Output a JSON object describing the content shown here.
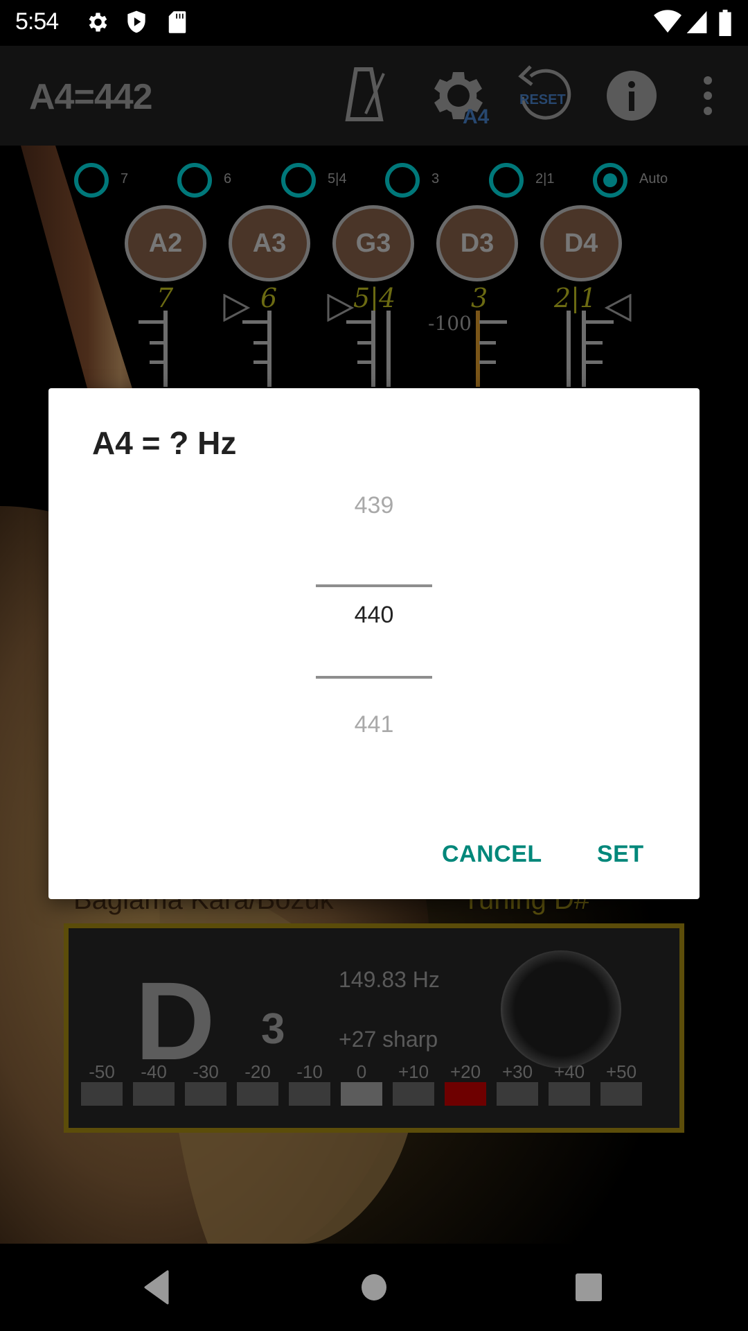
{
  "status_bar": {
    "time": "5:54",
    "left_icons": [
      "settings-icon",
      "shield-play-icon",
      "sd-card-icon"
    ],
    "right_icons": [
      "wifi-icon",
      "signal-icon",
      "battery-icon"
    ]
  },
  "toolbar": {
    "title": "A4=442",
    "actions": [
      {
        "name": "metronome-icon"
      },
      {
        "name": "a4-settings-icon",
        "badge": "A4"
      },
      {
        "name": "reset-icon",
        "badge": "RESET"
      },
      {
        "name": "info-icon"
      },
      {
        "name": "more-options-icon"
      }
    ]
  },
  "string_selector": {
    "options": [
      {
        "label": "7",
        "checked": false
      },
      {
        "label": "6",
        "checked": false
      },
      {
        "label": "5|4",
        "checked": false
      },
      {
        "label": "3",
        "checked": false
      },
      {
        "label": "2|1",
        "checked": false
      },
      {
        "label": "Auto",
        "checked": true
      }
    ],
    "accent_color": "#00787a"
  },
  "note_buttons": [
    "A2",
    "A3",
    "G3",
    "D3",
    "D4"
  ],
  "pegs": {
    "labels": [
      "7",
      "6",
      "5|4",
      "3",
      "2|1"
    ],
    "scale_label": "-100",
    "peg_label_color": "#6b6a12"
  },
  "instrument": {
    "name": "Bağlama Kara/Bozuk",
    "tuning": "Tuning D#"
  },
  "meter": {
    "note": "D",
    "octave": "3",
    "frequency": "149.83 Hz",
    "deviation": "+27 sharp",
    "scale": [
      "-50",
      "-40",
      "-30",
      "-20",
      "-10",
      "0",
      "+10",
      "+20",
      "+30",
      "+40",
      "+50"
    ],
    "active_index": 7,
    "center_index": 5,
    "active_color": "#6e0000"
  },
  "dialog": {
    "title": "A4 = ? Hz",
    "picker": {
      "previous": "439",
      "selected": "440",
      "next": "441"
    },
    "cancel_label": "CANCEL",
    "set_label": "SET",
    "button_color": "#00877a"
  },
  "nav_bar": {
    "buttons": [
      "back-icon",
      "home-icon",
      "recents-icon"
    ]
  }
}
